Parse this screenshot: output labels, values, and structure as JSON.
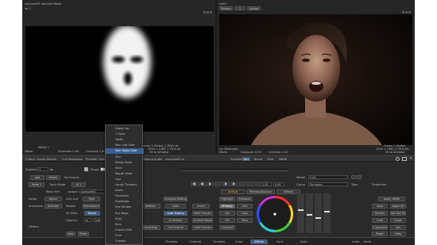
{
  "viewers": {
    "left": {
      "title": "oversize03 batches Matte",
      "subtitle": "se 1",
      "info_left_1": "Matte 1",
      "info_left_2": "Matte",
      "info_mid_1": "Expenses 0.00",
      "info_mid_2": "Contrast 1.00",
      "info_right_1": "Frame 2 Status_1 Pitch ok",
      "info_right_2": "1920 x 1080 1.78 8-bit",
      "info_right_3": "Fit to Window"
    },
    "right": {
      "title": "ref01",
      "tab_1": "Primary",
      "tab_2": "1",
      "tab_3": "Output",
      "info_left_1": "Lin Metadata",
      "info_left_2": "Mode",
      "info_mid_1": "Exposure 0.00",
      "info_mid_2": "Contrast 1.00",
      "info_right_1": "Frame 2 Status",
      "info_right_2": "1920 x 1080 1.78 8-bit",
      "info_right_3": "Fit to Window"
    }
  },
  "toolbar": {
    "item_1": "Cutout",
    "item_2": "Frame Default",
    "item_3": "Cut Resolution",
    "item_4": "Preview",
    "item_5": "Overlay",
    "item_6": "Gradient",
    "item_7": "Coloring",
    "item_8": "Audio",
    "item_9": "oversize03 el",
    "item_10": "Gradients",
    "item_11": "Any",
    "item_12": "Blend",
    "item_13": "Zero",
    "item_14": "Matte"
  },
  "dropdown": {
    "items": [
      "Upper Lip",
      "T Zone",
      "Teeth",
      "Skin Left Side",
      "Skin Right Side",
      "Skin",
      "Below Zone",
      "Shirt",
      "Mouth Mask",
      "Lips",
      "Laugh Tinaions",
      "Irises",
      "Forehead",
      "Eyebrows",
      "Eye Whites",
      "Eye Bags",
      "Eyes",
      "Ears",
      "Crow's Feet",
      "Chin",
      "Cheeks"
    ],
    "selected_index": 4
  },
  "left_panel": {
    "segment_label": "Segment",
    "segment_value": "1",
    "add_label": "Add",
    "delete_label": "Delete",
    "no_output": "No Output",
    "stage_label": "Stage",
    "stage_value": "1",
    "mode_label": "Mode 1",
    "type_label": "Track Mode",
    "track_value": "IS 1",
    "map_label": "Mask Mm",
    "map_value": "output",
    "map_field": "oversize03",
    "setup_label": "Setup",
    "setup_value": "Above",
    "link_label": "Link Iout",
    "type2_label": "Type",
    "animation_label": "Animation",
    "animate_btn": "Animate",
    "region_label": "Region",
    "track_btn": "Tracks/Anim",
    "blend_label": "Blend",
    "edge_label": "30 Mine",
    "opacity_label": "Opacity",
    "history_label": "History",
    "in_label": "In",
    "out_label": "Out",
    "new_btn": "New",
    "reset_btn": "Reset"
  },
  "center_panel": {
    "analysis_label": "Analysis Setting",
    "method_label": "Method",
    "clear_btn": "Clear",
    "invert_btn": "Invert",
    "auto_scaling": "Auto Scaling",
    "auto_value": "Both Frames",
    "surface_label": "Surface Mode",
    "in_feather": "In Feather",
    "out_feather": "Out Feather",
    "hold_frames": "Hold Frames",
    "smoothing": "Smoothing",
    "value_1": "0.00",
    "value_2": "1.00"
  },
  "color_panel": {
    "tab_1": "Default",
    "tab_2": "Primary/Balance",
    "tab_3": "Effects",
    "highlight_label": "Highlight",
    "shadow_label": "Shadows",
    "primary_label": "Primary",
    "hue_label": "Hue",
    "sat_label": "Sat",
    "gain_label": "Gain",
    "lift_label": "Lift",
    "tone_label": "Tone",
    "contrast_label": "Contrast"
  },
  "right_panel": {
    "wheel_label": "Wheel",
    "wheel_value": "0.00",
    "group_label": "Group",
    "group_value": "Surround",
    "type_label": "Type",
    "properties_label": "Properties",
    "apply_label": "Apply Matte",
    "input_label": "Input",
    "apply_all": "Apply All",
    "set_key": "Set Key",
    "set_key_all": "Set Key All",
    "hide": "Hide",
    "show": "Show",
    "ops": "Ops",
    "customize": "Customize",
    "reset": "Reset",
    "help": "Help"
  },
  "bottom_tabs": {
    "tab_1": "Timeline",
    "tab_2": "Contrast",
    "tab_3": "Timeline",
    "tab_4": "Color",
    "tab_5": "Effects",
    "tab_6": "Sync",
    "tab_7": "Data",
    "tab_8": "Undo",
    "tab_9": "Redo"
  },
  "colors": {
    "accent_orange": "#f0a000",
    "selection_blue": "#3a5f92",
    "panel_bg": "#2c2c2c"
  }
}
